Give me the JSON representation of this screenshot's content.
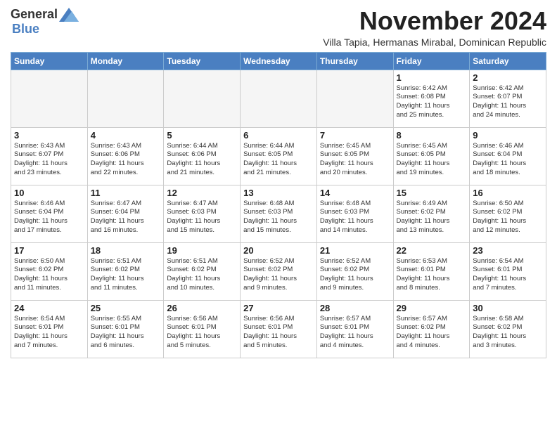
{
  "logo": {
    "general": "General",
    "blue": "Blue"
  },
  "title": "November 2024",
  "subtitle": "Villa Tapia, Hermanas Mirabal, Dominican Republic",
  "weekdays": [
    "Sunday",
    "Monday",
    "Tuesday",
    "Wednesday",
    "Thursday",
    "Friday",
    "Saturday"
  ],
  "weeks": [
    [
      {
        "day": "",
        "info": ""
      },
      {
        "day": "",
        "info": ""
      },
      {
        "day": "",
        "info": ""
      },
      {
        "day": "",
        "info": ""
      },
      {
        "day": "",
        "info": ""
      },
      {
        "day": "1",
        "info": "Sunrise: 6:42 AM\nSunset: 6:08 PM\nDaylight: 11 hours\nand 25 minutes."
      },
      {
        "day": "2",
        "info": "Sunrise: 6:42 AM\nSunset: 6:07 PM\nDaylight: 11 hours\nand 24 minutes."
      }
    ],
    [
      {
        "day": "3",
        "info": "Sunrise: 6:43 AM\nSunset: 6:07 PM\nDaylight: 11 hours\nand 23 minutes."
      },
      {
        "day": "4",
        "info": "Sunrise: 6:43 AM\nSunset: 6:06 PM\nDaylight: 11 hours\nand 22 minutes."
      },
      {
        "day": "5",
        "info": "Sunrise: 6:44 AM\nSunset: 6:06 PM\nDaylight: 11 hours\nand 21 minutes."
      },
      {
        "day": "6",
        "info": "Sunrise: 6:44 AM\nSunset: 6:05 PM\nDaylight: 11 hours\nand 21 minutes."
      },
      {
        "day": "7",
        "info": "Sunrise: 6:45 AM\nSunset: 6:05 PM\nDaylight: 11 hours\nand 20 minutes."
      },
      {
        "day": "8",
        "info": "Sunrise: 6:45 AM\nSunset: 6:05 PM\nDaylight: 11 hours\nand 19 minutes."
      },
      {
        "day": "9",
        "info": "Sunrise: 6:46 AM\nSunset: 6:04 PM\nDaylight: 11 hours\nand 18 minutes."
      }
    ],
    [
      {
        "day": "10",
        "info": "Sunrise: 6:46 AM\nSunset: 6:04 PM\nDaylight: 11 hours\nand 17 minutes."
      },
      {
        "day": "11",
        "info": "Sunrise: 6:47 AM\nSunset: 6:04 PM\nDaylight: 11 hours\nand 16 minutes."
      },
      {
        "day": "12",
        "info": "Sunrise: 6:47 AM\nSunset: 6:03 PM\nDaylight: 11 hours\nand 15 minutes."
      },
      {
        "day": "13",
        "info": "Sunrise: 6:48 AM\nSunset: 6:03 PM\nDaylight: 11 hours\nand 15 minutes."
      },
      {
        "day": "14",
        "info": "Sunrise: 6:48 AM\nSunset: 6:03 PM\nDaylight: 11 hours\nand 14 minutes."
      },
      {
        "day": "15",
        "info": "Sunrise: 6:49 AM\nSunset: 6:02 PM\nDaylight: 11 hours\nand 13 minutes."
      },
      {
        "day": "16",
        "info": "Sunrise: 6:50 AM\nSunset: 6:02 PM\nDaylight: 11 hours\nand 12 minutes."
      }
    ],
    [
      {
        "day": "17",
        "info": "Sunrise: 6:50 AM\nSunset: 6:02 PM\nDaylight: 11 hours\nand 11 minutes."
      },
      {
        "day": "18",
        "info": "Sunrise: 6:51 AM\nSunset: 6:02 PM\nDaylight: 11 hours\nand 11 minutes."
      },
      {
        "day": "19",
        "info": "Sunrise: 6:51 AM\nSunset: 6:02 PM\nDaylight: 11 hours\nand 10 minutes."
      },
      {
        "day": "20",
        "info": "Sunrise: 6:52 AM\nSunset: 6:02 PM\nDaylight: 11 hours\nand 9 minutes."
      },
      {
        "day": "21",
        "info": "Sunrise: 6:52 AM\nSunset: 6:02 PM\nDaylight: 11 hours\nand 9 minutes."
      },
      {
        "day": "22",
        "info": "Sunrise: 6:53 AM\nSunset: 6:01 PM\nDaylight: 11 hours\nand 8 minutes."
      },
      {
        "day": "23",
        "info": "Sunrise: 6:54 AM\nSunset: 6:01 PM\nDaylight: 11 hours\nand 7 minutes."
      }
    ],
    [
      {
        "day": "24",
        "info": "Sunrise: 6:54 AM\nSunset: 6:01 PM\nDaylight: 11 hours\nand 7 minutes."
      },
      {
        "day": "25",
        "info": "Sunrise: 6:55 AM\nSunset: 6:01 PM\nDaylight: 11 hours\nand 6 minutes."
      },
      {
        "day": "26",
        "info": "Sunrise: 6:56 AM\nSunset: 6:01 PM\nDaylight: 11 hours\nand 5 minutes."
      },
      {
        "day": "27",
        "info": "Sunrise: 6:56 AM\nSunset: 6:01 PM\nDaylight: 11 hours\nand 5 minutes."
      },
      {
        "day": "28",
        "info": "Sunrise: 6:57 AM\nSunset: 6:01 PM\nDaylight: 11 hours\nand 4 minutes."
      },
      {
        "day": "29",
        "info": "Sunrise: 6:57 AM\nSunset: 6:02 PM\nDaylight: 11 hours\nand 4 minutes."
      },
      {
        "day": "30",
        "info": "Sunrise: 6:58 AM\nSunset: 6:02 PM\nDaylight: 11 hours\nand 3 minutes."
      }
    ]
  ]
}
